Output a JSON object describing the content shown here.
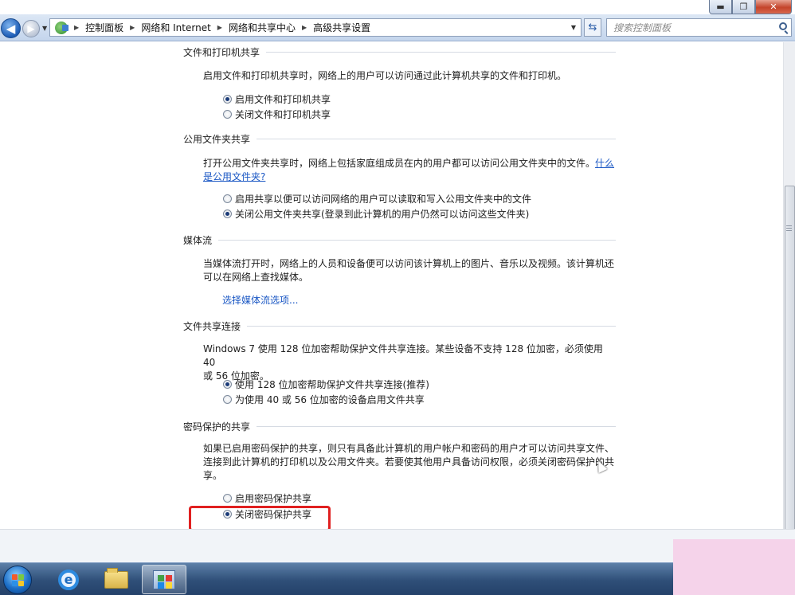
{
  "window": {
    "caption_buttons": [
      "minimize",
      "maximize",
      "close"
    ]
  },
  "navigation": {
    "breadcrumbs": [
      "控制面板",
      "网络和 Internet",
      "网络和共享中心",
      "高级共享设置"
    ],
    "search_placeholder": "搜索控制面板"
  },
  "sections": [
    {
      "title": "文件和打印机共享",
      "description": "启用文件和打印机共享时，网络上的用户可以访问通过此计算机共享的文件和打印机。",
      "options": [
        {
          "label": "启用文件和打印机共享",
          "selected": true
        },
        {
          "label": "关闭文件和打印机共享",
          "selected": false
        }
      ]
    },
    {
      "title": "公用文件夹共享",
      "description": "打开公用文件夹共享时，网络上包括家庭组成员在内的用户都可以访问公用文件夹中的文件。",
      "link_part1": "什么",
      "link_part2": "是公用文件夹?",
      "options": [
        {
          "label": "启用共享以便可以访问网络的用户可以读取和写入公用文件夹中的文件",
          "selected": false
        },
        {
          "label": "关闭公用文件夹共享(登录到此计算机的用户仍然可以访问这些文件夹)",
          "selected": true
        }
      ]
    },
    {
      "title": "媒体流",
      "description_line1": "当媒体流打开时，网络上的人员和设备便可以访问该计算机上的图片、音乐以及视频。该计算机还",
      "description_line2": "可以在网络上查找媒体。",
      "link": "选择媒体流选项..."
    },
    {
      "title": "文件共享连接",
      "description_line1": "Windows 7 使用 128 位加密帮助保护文件共享连接。某些设备不支持 128 位加密，必须使用 40",
      "description_line2": "或 56 位加密。",
      "options": [
        {
          "label": "使用 128 位加密帮助保护文件共享连接(推荐)",
          "selected": true
        },
        {
          "label": "为使用 40 或 56 位加密的设备启用文件共享",
          "selected": false
        }
      ]
    },
    {
      "title": "密码保护的共享",
      "description_line1": "如果已启用密码保护的共享，则只有具备此计算机的用户帐户和密码的用户才可以访问共享文件、",
      "description_line2": "连接到此计算机的打印机以及公用文件夹。若要使其他用户具备访问权限，必须关闭密码保护的共",
      "description_line3": "享。",
      "options": [
        {
          "label": "启用密码保护共享",
          "selected": false
        },
        {
          "label": "关闭密码保护共享",
          "selected": true
        }
      ]
    }
  ],
  "colors": {
    "link": "#1a57c4",
    "highlight_box": "#e02020"
  },
  "taskbar": {
    "items": [
      "start-orb",
      "internet-explorer-icon",
      "folder-icon",
      "control-panel-icon"
    ]
  }
}
